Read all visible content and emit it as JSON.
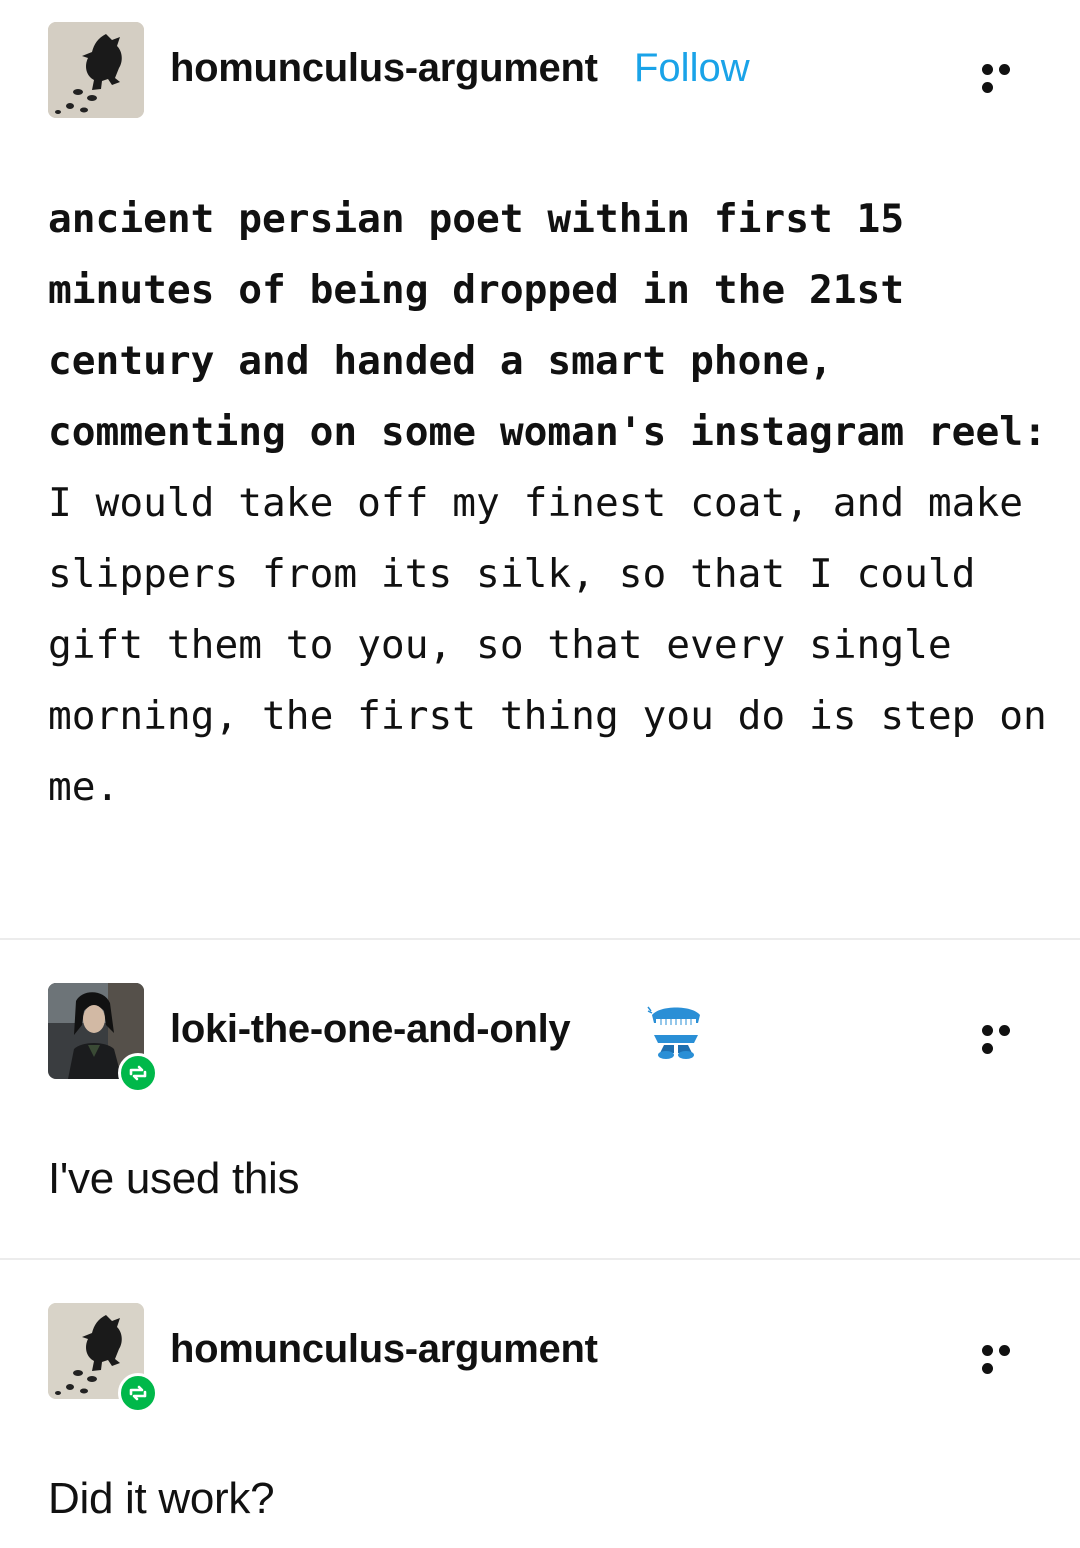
{
  "post1": {
    "username": "homunculus-argument",
    "follow_label": "Follow",
    "avatar_icon": "gremlin-footprints-avatar",
    "more_icon": "more-dots-icon",
    "text_bold": "ancient persian poet within first 15 minutes of being dropped in the 21st century and handed a smart phone, commenting on some woman's instagram reel:",
    "text_normal": " I would take off my finest coat, and make slippers from its silk, so that I could gift them to you, so that every single morning, the first thing you do is step on me."
  },
  "post2": {
    "username": "loki-the-one-and-only",
    "avatar_icon": "loki-avatar",
    "badge_icon": "chattering-teeth-icon",
    "reblog_icon": "reblog-icon",
    "more_icon": "more-dots-icon",
    "text": "I've used this"
  },
  "post3": {
    "username": "homunculus-argument",
    "avatar_icon": "gremlin-footprints-avatar",
    "reblog_icon": "reblog-icon",
    "more_icon": "more-dots-icon",
    "text": "Did it work?"
  },
  "colors": {
    "follow": "#1aa3e8",
    "reblog_badge": "#00b84a",
    "divider": "#ececec"
  }
}
